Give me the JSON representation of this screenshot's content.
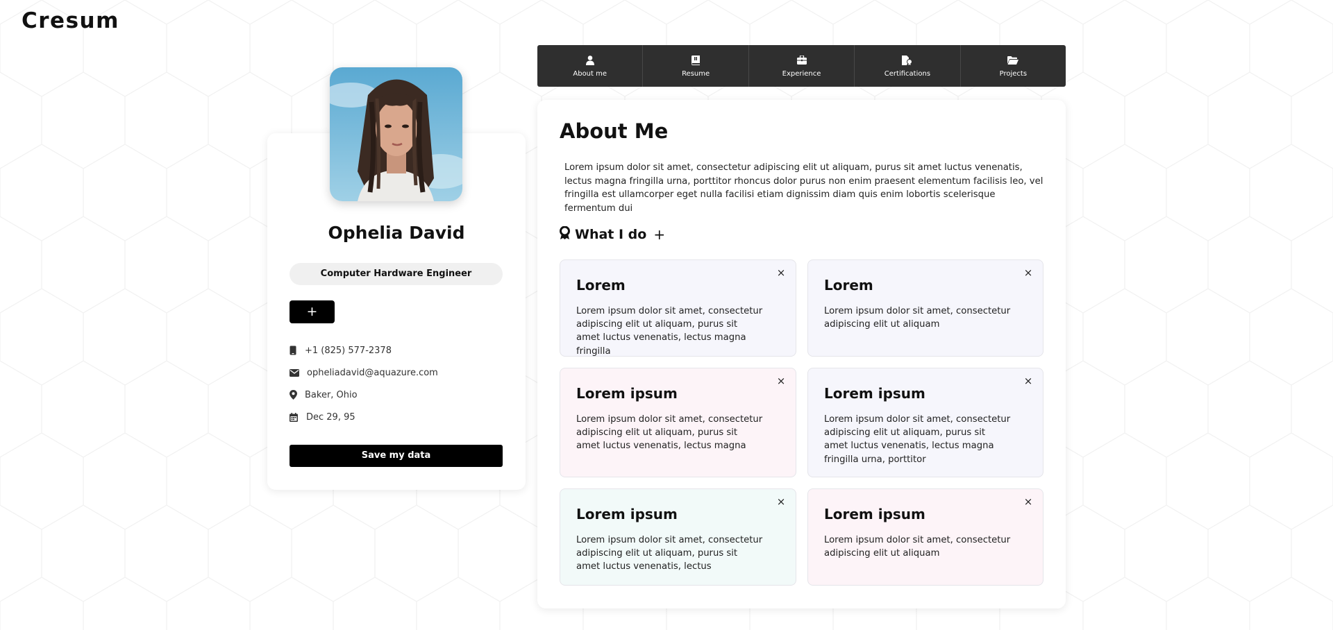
{
  "brand": {
    "logo": "Cresum"
  },
  "profile": {
    "name": "Ophelia David",
    "job_title": "Computer Hardware Engineer",
    "add_button": "+",
    "contacts": [
      {
        "icon": "phone-icon",
        "text": "+1 (825) 577-2378"
      },
      {
        "icon": "envelope-icon",
        "text": "opheliadavid@aquazure.com"
      },
      {
        "icon": "location-pin-icon",
        "text": "Baker, Ohio"
      },
      {
        "icon": "calendar-icon",
        "text": "Dec 29, 95"
      }
    ],
    "save_button": "Save my data"
  },
  "nav": {
    "tabs": [
      {
        "label": "About me",
        "icon": "user-icon"
      },
      {
        "label": "Resume",
        "icon": "book-icon"
      },
      {
        "label": "Experience",
        "icon": "briefcase-icon"
      },
      {
        "label": "Certifications",
        "icon": "certificate-icon"
      },
      {
        "label": "Projects",
        "icon": "folder-icon"
      }
    ]
  },
  "about": {
    "title": "About Me",
    "text": "Lorem ipsum dolor sit amet, consectetur adipiscing elit ut aliquam, purus sit amet luctus venenatis, lectus magna fringilla urna, porttitor rhoncus dolor purus non enim praesent elementum facilisis leo, vel fringilla est ullamcorper eget nulla facilisi etiam dignissim diam quis enim lobortis scelerisque fermentum dui"
  },
  "what_i_do": {
    "title": "What I do",
    "add": "+",
    "close_symbol": "×",
    "cards": [
      {
        "title": "Lorem",
        "text": "Lorem ipsum dolor sit amet, consectetur adipiscing elit ut aliquam, purus sit amet luctus venenatis, lectus magna fringilla",
        "bg": "#f6f6fc"
      },
      {
        "title": "Lorem",
        "text": "Lorem ipsum dolor sit amet, consectetur adipiscing elit ut aliquam",
        "bg": "#f6f6fc"
      },
      {
        "title": "Lorem ipsum",
        "text": "Lorem ipsum dolor sit amet, consectetur adipiscing elit ut aliquam, purus sit amet luctus venenatis, lectus magna",
        "bg": "#fdf4f8"
      },
      {
        "title": "Lorem ipsum",
        "text": "Lorem ipsum dolor sit amet, consectetur adipiscing elit ut aliquam, purus sit amet luctus venenatis, lectus magna fringilla urna, porttitor",
        "bg": "#f6f6fc"
      },
      {
        "title": "Lorem ipsum",
        "text": "Lorem ipsum dolor sit amet, consectetur adipiscing elit ut aliquam, purus sit amet luctus venenatis, lectus",
        "bg": "#f2faf9"
      },
      {
        "title": "Lorem ipsum",
        "text": "Lorem ipsum dolor sit amet, consectetur adipiscing elit ut aliquam",
        "bg": "#fdf4f8"
      }
    ]
  }
}
